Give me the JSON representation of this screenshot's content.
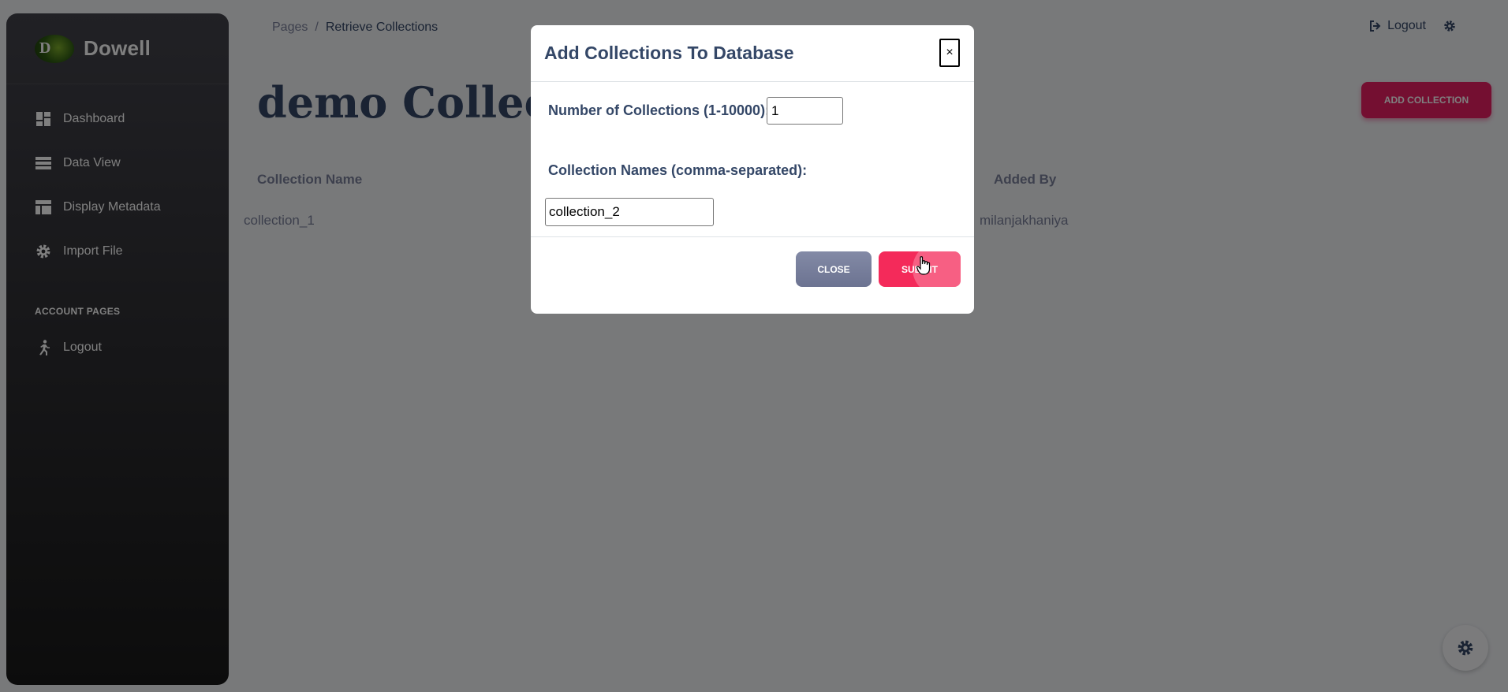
{
  "sidebar": {
    "brand": {
      "logo_text": "D",
      "name": "Dowell"
    },
    "items": [
      {
        "label": "Dashboard",
        "icon": "dashboard-icon"
      },
      {
        "label": "Data View",
        "icon": "storage-icon"
      },
      {
        "label": "Display Metadata",
        "icon": "table-icon"
      },
      {
        "label": "Import File",
        "icon": "gear-icon"
      }
    ],
    "section_label": "ACCOUNT PAGES",
    "account_items": [
      {
        "label": "Logout",
        "icon": "runner-icon"
      }
    ]
  },
  "header": {
    "breadcrumb": {
      "root": "Pages",
      "separator": "/",
      "current": "Retrieve Collections"
    },
    "logout_label": "Logout"
  },
  "main": {
    "title": "demo Collections",
    "add_button_label": "ADD COLLECTION",
    "table": {
      "columns": [
        "Collection Name",
        "Added By"
      ],
      "rows": [
        [
          "collection_1",
          "milanjakhaniya"
        ]
      ]
    }
  },
  "modal": {
    "title": "Add Collections To Database",
    "close_x": "×",
    "count_label": "Number of Collections (1-10000):",
    "count_value": "1",
    "names_label": "Collection Names (comma-separated):",
    "names_value": "collection_2",
    "close_button": "CLOSE",
    "submit_button": "SUBMIT"
  },
  "colors": {
    "accent": "#e91e63",
    "sidebar_dark": "#191919",
    "text_primary": "#344767",
    "text_secondary": "#7b809a"
  }
}
